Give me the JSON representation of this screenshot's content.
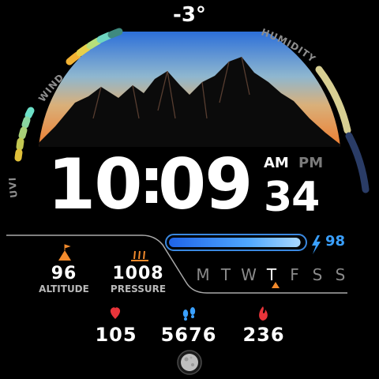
{
  "weather": {
    "temperature": "-3°"
  },
  "complications": {
    "wind_label": "WIND",
    "humidity_label": "HUMIDITY",
    "uvi_label": "UVI"
  },
  "time": {
    "hours": "10",
    "minutes": "09",
    "seconds": "34",
    "am_label": "AM",
    "pm_label": "PM",
    "active_period": "AM"
  },
  "battery": {
    "value": "98",
    "level_percent": 98,
    "icon": "lightning-bolt-icon"
  },
  "stats": {
    "altitude": {
      "value": "96",
      "label": "ALTITUDE",
      "icon": "mountain-flag-icon"
    },
    "pressure": {
      "value": "1008",
      "label": "PRESSURE",
      "icon": "pressure-gauge-icon"
    }
  },
  "week": {
    "days": [
      "M",
      "T",
      "W",
      "T",
      "F",
      "S",
      "S"
    ],
    "active_index": 3
  },
  "bottom": {
    "heart_rate": {
      "value": "105",
      "icon": "heart-icon"
    },
    "steps": {
      "value": "5676",
      "icon": "footsteps-icon"
    },
    "calories": {
      "value": "236",
      "icon": "flame-icon"
    },
    "moon_icon": "moon-phase-icon"
  },
  "colors": {
    "accent_blue": "#3aa0ff",
    "orange": "#f28a2c",
    "red": "#e8343a",
    "sky_top": "#2d6fd8",
    "sky_bottom": "#f07a2a"
  }
}
